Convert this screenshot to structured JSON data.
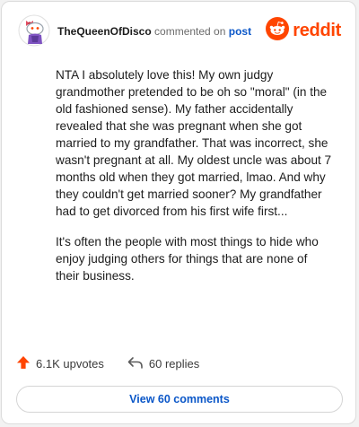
{
  "header": {
    "username": "TheQueenOfDisco",
    "action_text": "commented on",
    "post_link": "post",
    "brand": "reddit"
  },
  "comment": {
    "paragraphs": [
      "NTA I absolutely love this! My own judgy grandmother pretended to be oh so \"moral\" (in the old fashioned sense). My father accidentally revealed that she was pregnant when she got married to my grandfather. That was incorrect, she wasn't pregnant at all. My oldest uncle was about 7 months old when they got married, lmao. And why they couldn't get married sooner? My grandfather had to get divorced from his first wife first...",
      "It's often the people with most things to hide who enjoy judging others for things that are none of their business."
    ]
  },
  "stats": {
    "upvotes": "6.1K upvotes",
    "replies": "60 replies"
  },
  "footer": {
    "view_comments": "View 60 comments"
  },
  "colors": {
    "brand": "#ff4500",
    "link": "#0b57c8"
  },
  "icons": {
    "avatar": "snoo-avatar-icon",
    "logo": "reddit-logo-icon",
    "upvote": "upvote-arrow-icon",
    "reply": "reply-arrow-icon"
  }
}
